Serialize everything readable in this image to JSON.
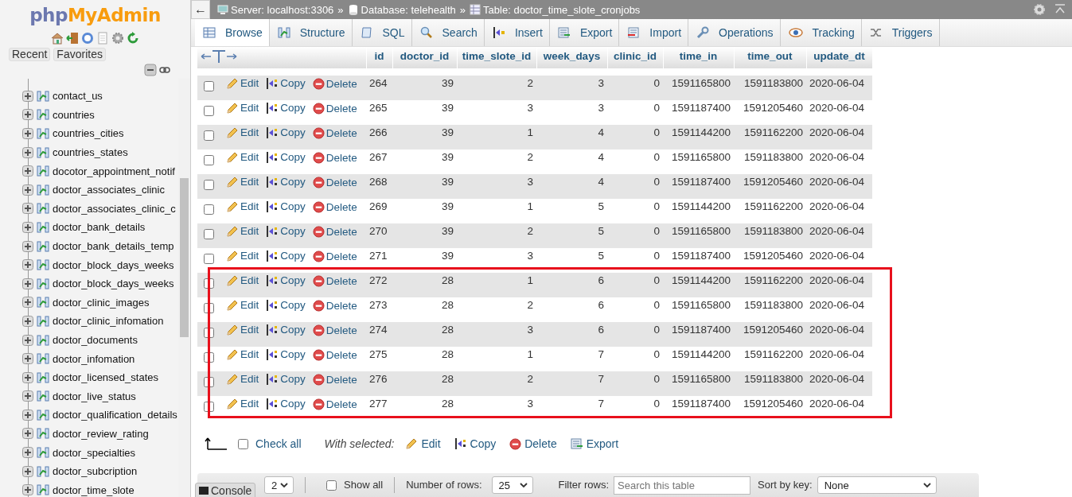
{
  "logo": {
    "php": "php",
    "rest": "MyAdmin"
  },
  "sidebar": {
    "buttons": [
      "Recent",
      "Favorites"
    ],
    "tables": [
      "contact_us",
      "countries",
      "countries_cities",
      "countries_states",
      "docotor_appointment_notif",
      "doctor_associates_clinic",
      "doctor_associates_clinic_c",
      "doctor_bank_details",
      "doctor_bank_details_temp",
      "doctor_block_days_weeks",
      "doctor_block_days_weeks",
      "doctor_clinic_images",
      "doctor_clinic_infomation",
      "doctor_documents",
      "doctor_infomation",
      "doctor_licensed_states",
      "doctor_live_status",
      "doctor_qualification_details",
      "doctor_review_rating",
      "doctor_specialties",
      "doctor_subcription",
      "doctor_time_slote"
    ]
  },
  "breadcrumb": {
    "separator": "»",
    "items": [
      {
        "kind": "server",
        "label": "Server: localhost:3306"
      },
      {
        "kind": "database",
        "label": "Database: telehealth"
      },
      {
        "kind": "table",
        "label": "Table: doctor_time_slote_cronjobs"
      }
    ]
  },
  "back_arrow": "←",
  "tabs": [
    {
      "kind": "browse",
      "label": "Browse",
      "selected": true
    },
    {
      "kind": "structure",
      "label": "Structure",
      "selected": false
    },
    {
      "kind": "sql",
      "label": "SQL",
      "selected": false
    },
    {
      "kind": "search",
      "label": "Search",
      "selected": false
    },
    {
      "kind": "insert",
      "label": "Insert",
      "selected": false
    },
    {
      "kind": "export",
      "label": "Export",
      "selected": false
    },
    {
      "kind": "import",
      "label": "Import",
      "selected": false
    },
    {
      "kind": "operations",
      "label": "Operations",
      "selected": false
    },
    {
      "kind": "tracking",
      "label": "Tracking",
      "selected": false
    },
    {
      "kind": "triggers",
      "label": "Triggers",
      "selected": false
    }
  ],
  "table": {
    "columns": [
      "id",
      "doctor_id",
      "time_slote_id",
      "week_days",
      "clinic_id",
      "time_in",
      "time_out",
      "update_dt"
    ],
    "rows": [
      {
        "checked": false,
        "highlighted": false,
        "actions": [
          "Edit",
          "Copy",
          "Delete"
        ],
        "cells": [
          "264",
          "39",
          "2",
          "3",
          "0",
          "1591165800",
          "1591183800",
          "2020-06-04"
        ]
      },
      {
        "checked": false,
        "highlighted": false,
        "actions": [
          "Edit",
          "Copy",
          "Delete"
        ],
        "cells": [
          "265",
          "39",
          "3",
          "3",
          "0",
          "1591187400",
          "1591205460",
          "2020-06-04"
        ]
      },
      {
        "checked": false,
        "highlighted": false,
        "actions": [
          "Edit",
          "Copy",
          "Delete"
        ],
        "cells": [
          "266",
          "39",
          "1",
          "4",
          "0",
          "1591144200",
          "1591162200",
          "2020-06-04"
        ]
      },
      {
        "checked": false,
        "highlighted": false,
        "actions": [
          "Edit",
          "Copy",
          "Delete"
        ],
        "cells": [
          "267",
          "39",
          "2",
          "4",
          "0",
          "1591165800",
          "1591183800",
          "2020-06-04"
        ]
      },
      {
        "checked": false,
        "highlighted": false,
        "actions": [
          "Edit",
          "Copy",
          "Delete"
        ],
        "cells": [
          "268",
          "39",
          "3",
          "4",
          "0",
          "1591187400",
          "1591205460",
          "2020-06-04"
        ]
      },
      {
        "checked": false,
        "highlighted": false,
        "actions": [
          "Edit",
          "Copy",
          "Delete"
        ],
        "cells": [
          "269",
          "39",
          "1",
          "5",
          "0",
          "1591144200",
          "1591162200",
          "2020-06-04"
        ]
      },
      {
        "checked": false,
        "highlighted": false,
        "actions": [
          "Edit",
          "Copy",
          "Delete"
        ],
        "cells": [
          "270",
          "39",
          "2",
          "5",
          "0",
          "1591165800",
          "1591183800",
          "2020-06-04"
        ]
      },
      {
        "checked": false,
        "highlighted": false,
        "actions": [
          "Edit",
          "Copy",
          "Delete"
        ],
        "cells": [
          "271",
          "39",
          "3",
          "5",
          "0",
          "1591187400",
          "1591205460",
          "2020-06-04"
        ]
      },
      {
        "checked": false,
        "highlighted": true,
        "actions": [
          "Edit",
          "Copy",
          "Delete"
        ],
        "cells": [
          "272",
          "28",
          "1",
          "6",
          "0",
          "1591144200",
          "1591162200",
          "2020-06-04"
        ]
      },
      {
        "checked": false,
        "highlighted": true,
        "actions": [
          "Edit",
          "Copy",
          "Delete"
        ],
        "cells": [
          "273",
          "28",
          "2",
          "6",
          "0",
          "1591165800",
          "1591183800",
          "2020-06-04"
        ]
      },
      {
        "checked": false,
        "highlighted": true,
        "actions": [
          "Edit",
          "Copy",
          "Delete"
        ],
        "cells": [
          "274",
          "28",
          "3",
          "6",
          "0",
          "1591187400",
          "1591205460",
          "2020-06-04"
        ]
      },
      {
        "checked": false,
        "highlighted": true,
        "actions": [
          "Edit",
          "Copy",
          "Delete"
        ],
        "cells": [
          "275",
          "28",
          "1",
          "7",
          "0",
          "1591144200",
          "1591162200",
          "2020-06-04"
        ]
      },
      {
        "checked": false,
        "highlighted": true,
        "actions": [
          "Edit",
          "Copy",
          "Delete"
        ],
        "cells": [
          "276",
          "28",
          "2",
          "7",
          "0",
          "1591165800",
          "1591183800",
          "2020-06-04"
        ]
      },
      {
        "checked": false,
        "highlighted": true,
        "actions": [
          "Edit",
          "Copy",
          "Delete"
        ],
        "cells": [
          "277",
          "28",
          "3",
          "7",
          "0",
          "1591187400",
          "1591205460",
          "2020-06-04"
        ]
      }
    ]
  },
  "bulk": {
    "check_all": {
      "label": "Check all",
      "checked": false
    },
    "with_selected": "With selected:",
    "actions": [
      {
        "kind": "edit",
        "label": "Edit"
      },
      {
        "kind": "copy",
        "label": "Copy"
      },
      {
        "kind": "delete",
        "label": "Delete"
      },
      {
        "kind": "export",
        "label": "Export"
      }
    ]
  },
  "footer": {
    "page": "2",
    "show_all": {
      "label": "Show all",
      "checked": false
    },
    "rows_label": "Number of rows:",
    "rows_value": "25",
    "filter_label": "Filter rows:",
    "filter_placeholder": "Search this table",
    "sort_label": "Sort by key:",
    "sort_value": "None"
  },
  "console": "Console"
}
